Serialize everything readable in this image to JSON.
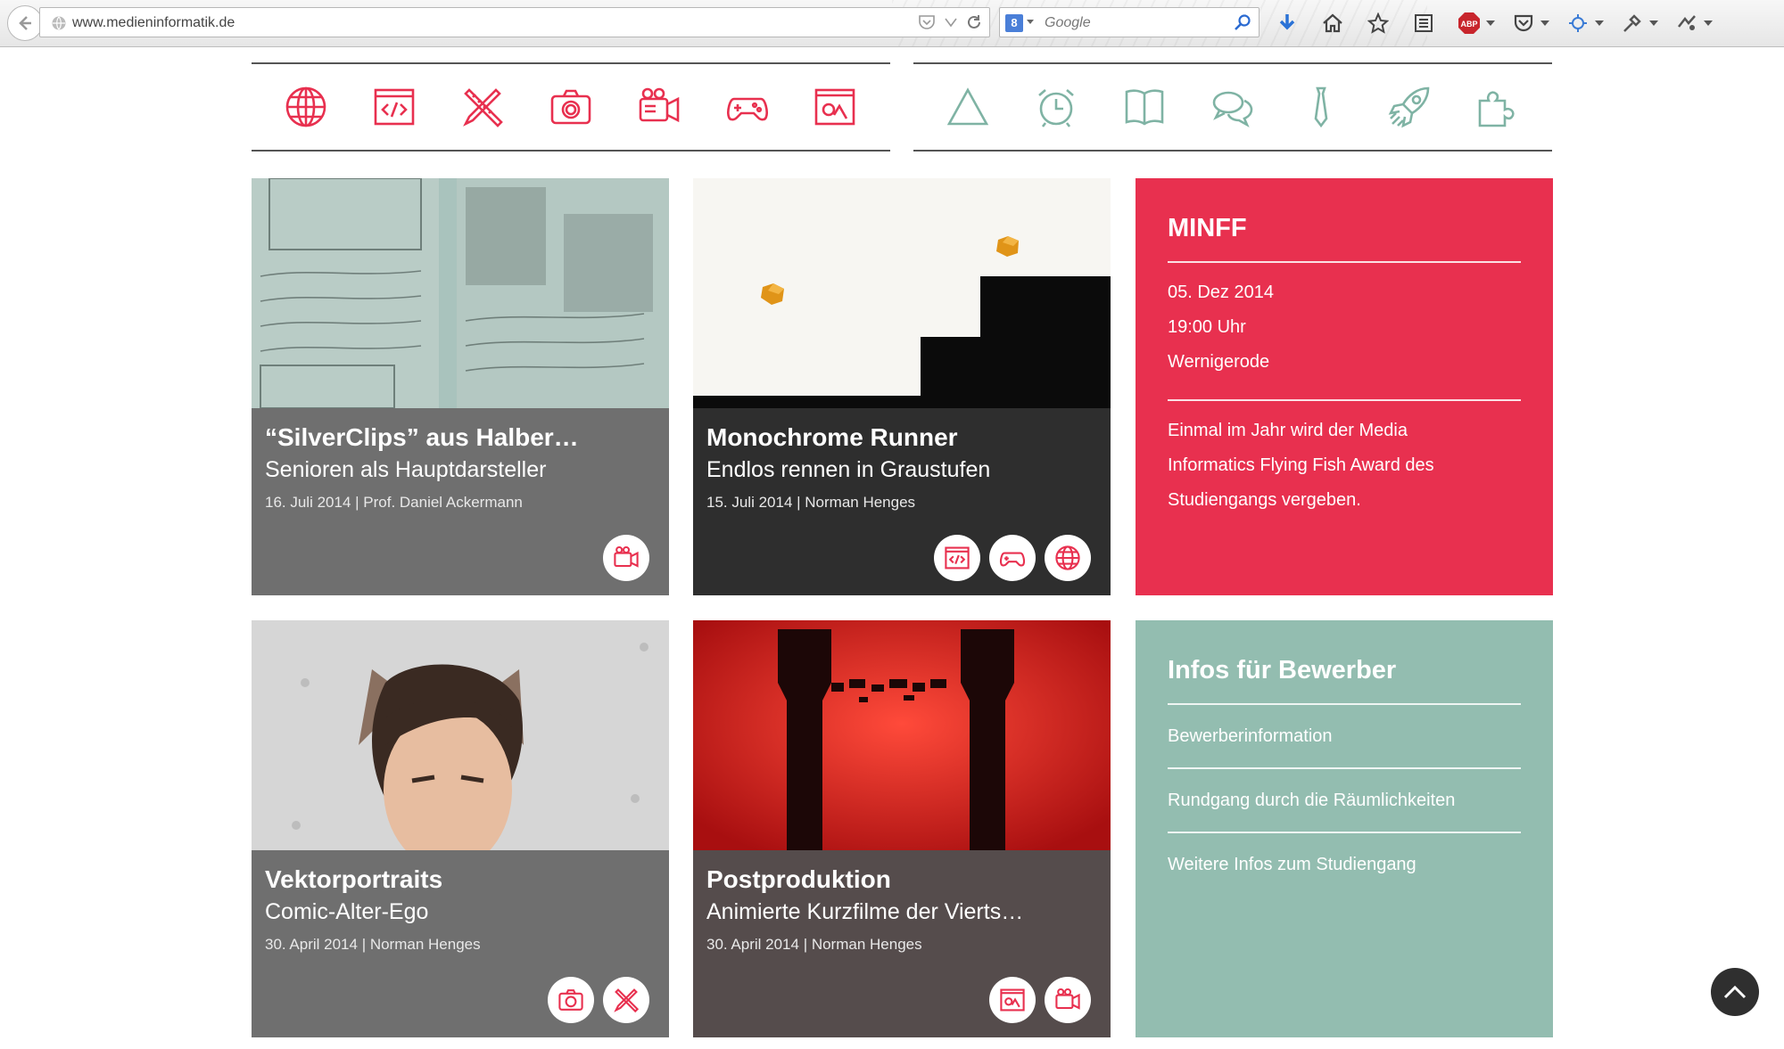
{
  "browser": {
    "url": "www.medieninformatik.de",
    "search_placeholder": "Google",
    "search_engine_label": "8"
  },
  "nav": {
    "left_icons": [
      "globe-icon",
      "code-icon",
      "ruler-pencil-icon",
      "camera-icon",
      "video-camera-icon",
      "gamepad-icon",
      "image-icon"
    ],
    "right_icons": [
      "triangle-icon",
      "alarm-clock-icon",
      "book-icon",
      "chat-icon",
      "tie-icon",
      "rocket-icon",
      "puzzle-icon"
    ],
    "left_color": "#e8304f",
    "right_color": "#7fb3a4"
  },
  "projects": [
    {
      "title": "“SilverClips” aus Halber…",
      "subtitle": "Senioren als Hauptdarsteller",
      "meta": "16. Juli 2014 | Prof. Daniel Ackermann",
      "tags": [
        "video-camera-icon"
      ]
    },
    {
      "title": "Monochrome Runner",
      "subtitle": "Endlos rennen in Graustufen",
      "meta": "15. Juli 2014 | Norman Henges",
      "tags": [
        "code-icon",
        "gamepad-icon",
        "globe-icon"
      ]
    },
    {
      "title": "Vektorportraits",
      "subtitle": "Comic-Alter-Ego",
      "meta": "30. April 2014 | Norman Henges",
      "tags": [
        "camera-icon",
        "ruler-pencil-icon"
      ]
    },
    {
      "title": "Postproduktion",
      "subtitle": "Animierte Kurzfilme der Vierts…",
      "meta": "30. April 2014 | Norman Henges",
      "tags": [
        "image-icon",
        "video-camera-icon"
      ]
    }
  ],
  "event": {
    "title": "MINFF",
    "date": "05. Dez 2014",
    "time": "19:00 Uhr",
    "location": "Wernigerode",
    "desc1": "Einmal im Jahr wird der Media",
    "desc2": "Informatics Flying Fish Award des",
    "desc3": "Studiengangs vergeben.",
    "color": "#e8304f"
  },
  "applicants": {
    "title": "Infos für Bewerber",
    "links": [
      "Bewerberinformation",
      "Rundgang durch die Räumlichkeiten",
      "Weitere Infos zum Studiengang"
    ],
    "color": "#93bdb0"
  }
}
